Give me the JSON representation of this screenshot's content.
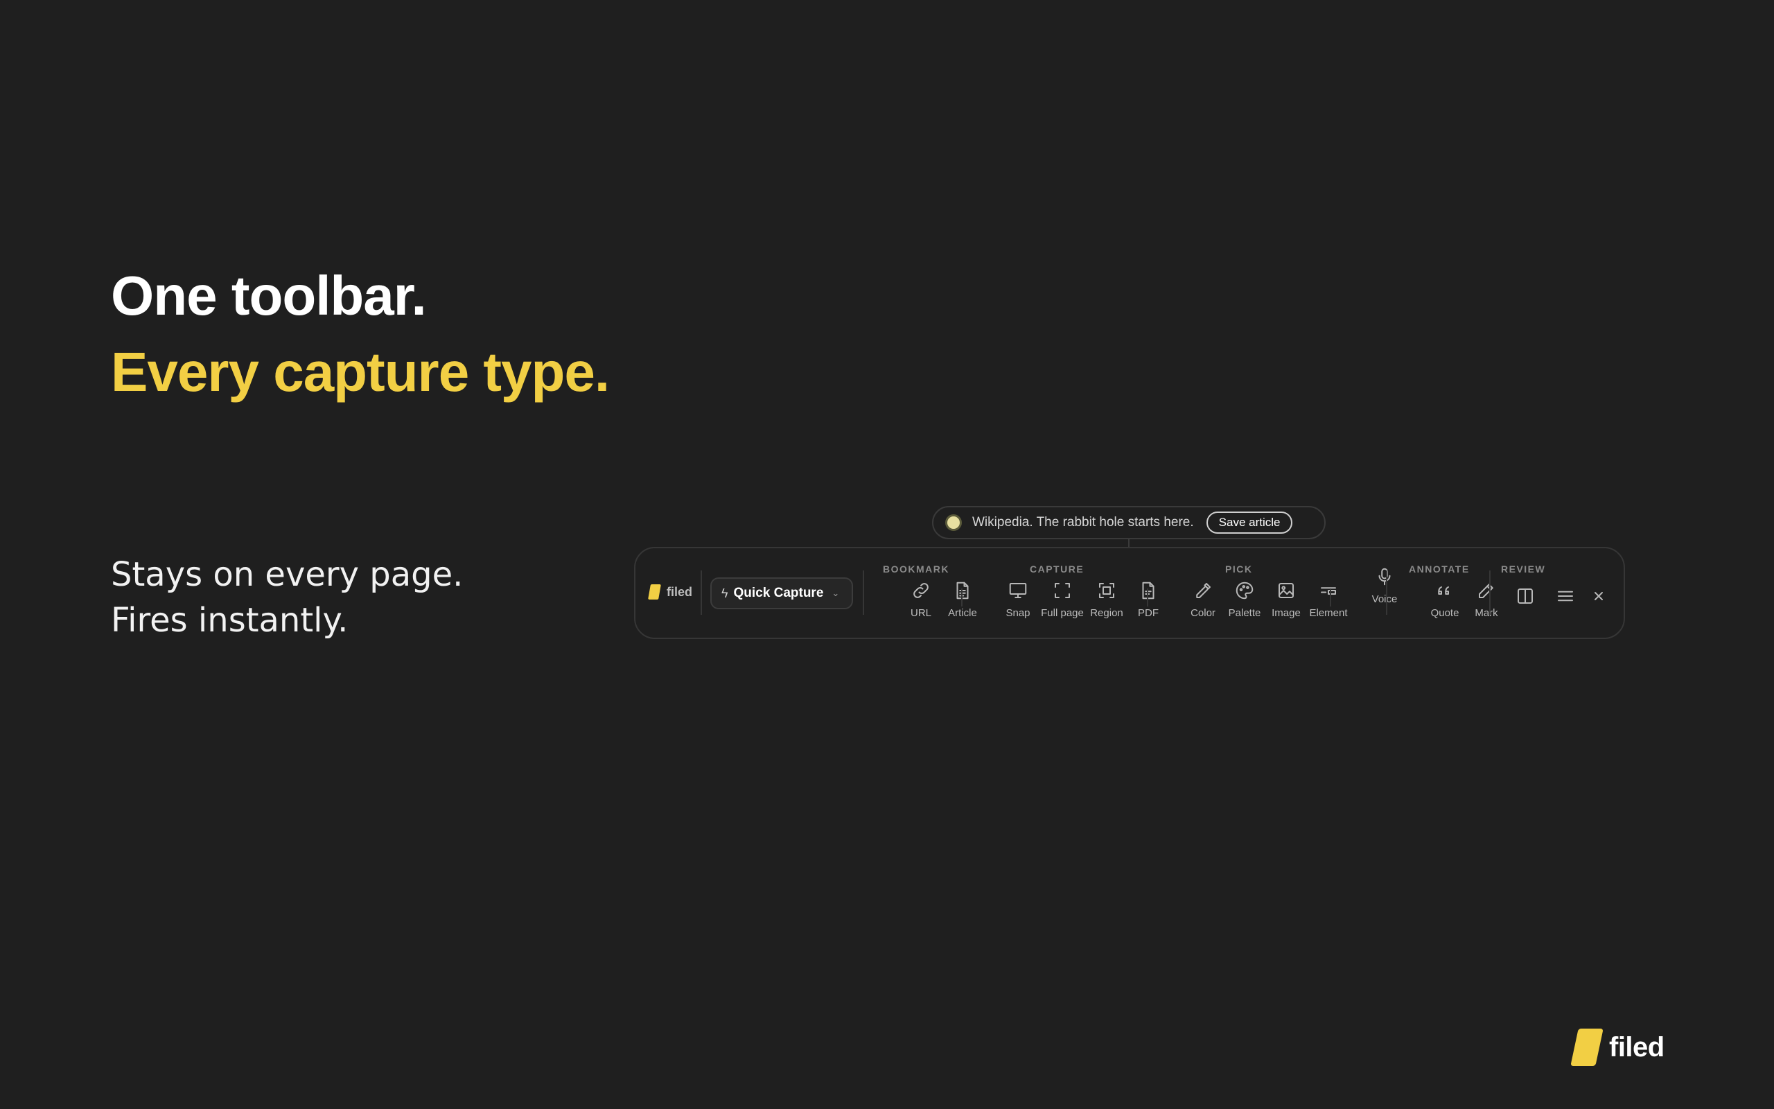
{
  "headline": {
    "line1": "One toolbar.",
    "line2": "Every capture type."
  },
  "tagline": {
    "line1": "Stays on every page.",
    "line2": "Fires instantly."
  },
  "notice": {
    "message": "Wikipedia. The rabbit hole starts here.",
    "button": "Save article"
  },
  "toolbar": {
    "logo": "filed",
    "quick_capture": "Quick Capture",
    "groups": {
      "bookmark": "BOOKMARK",
      "capture": "CAPTURE",
      "pick": "PICK",
      "annotate": "ANNOTATE",
      "review": "REVIEW"
    },
    "tools": {
      "url": "URL",
      "article": "Article",
      "snap": "Snap",
      "full_page": "Full page",
      "region": "Region",
      "pdf": "PDF",
      "color": "Color",
      "palette": "Palette",
      "image": "Image",
      "element": "Element",
      "voice": "Voice",
      "quote": "Quote",
      "mark": "Mark"
    }
  },
  "brand": {
    "name": "filed",
    "accent": "#f2cf44"
  }
}
